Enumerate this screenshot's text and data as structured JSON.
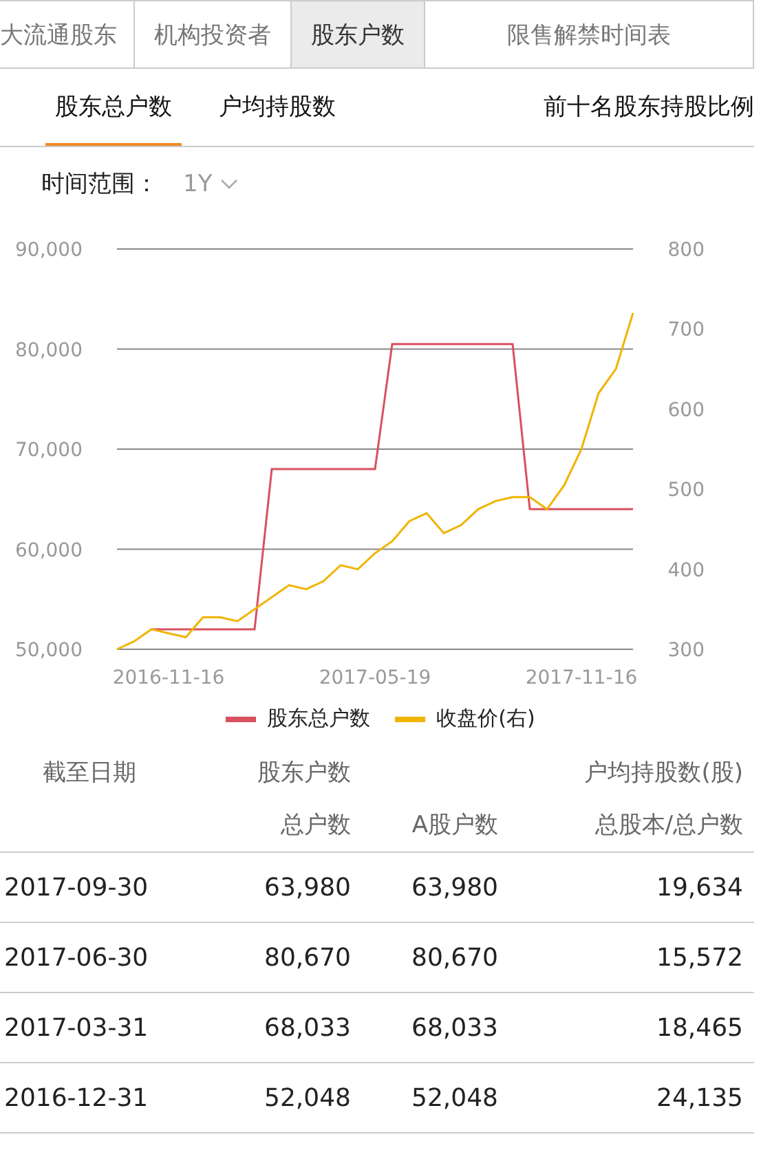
{
  "tabs": [
    {
      "label": "大流通股东",
      "selected": false
    },
    {
      "label": "机构投资者",
      "selected": false
    },
    {
      "label": "股东户数",
      "selected": true
    },
    {
      "label": "限售解禁时间表",
      "selected": false
    }
  ],
  "sub_tabs": [
    {
      "label": "股东总户数",
      "selected": true
    },
    {
      "label": "户均持股数",
      "selected": false
    },
    {
      "label": "前十名股东持股比例",
      "selected": false
    }
  ],
  "time_range": {
    "label": "时间范围：",
    "value": "1Y"
  },
  "chart": {
    "chart_data": {
      "type": "line",
      "categories": [
        null,
        null,
        null,
        "2016-11-16",
        null,
        null,
        null,
        null,
        null,
        null,
        null,
        null,
        null,
        null,
        null,
        "2017-05-19",
        null,
        null,
        null,
        null,
        null,
        null,
        null,
        null,
        null,
        null,
        null,
        "2017-11-16",
        null,
        null,
        null
      ],
      "ylim": [
        50000,
        90000
      ],
      "yticks": [
        {
          "value": 50000,
          "label": "50,000"
        },
        {
          "value": 60000,
          "label": "60,000"
        },
        {
          "value": 70000,
          "label": "70,000"
        },
        {
          "value": 80000,
          "label": "80,000"
        },
        {
          "value": 90000,
          "label": "90,000"
        }
      ],
      "grid": true,
      "legend": "bottom",
      "y2lim": [
        300,
        800
      ],
      "y2ticks": [
        300,
        400,
        500,
        600,
        700,
        800
      ],
      "series": [
        {
          "name": "股东总户数",
          "color": "#d9505f",
          "values": [
            null,
            null,
            52000,
            52000,
            52000,
            52000,
            52000,
            52000,
            52000,
            68000,
            68000,
            68000,
            68000,
            68000,
            68000,
            68000,
            80500,
            80500,
            80500,
            80500,
            80500,
            80500,
            80500,
            80500,
            64000,
            64000,
            64000,
            64000,
            64000,
            64000,
            64000
          ]
        },
        {
          "name": "收盘价(右)",
          "color": "#f0b400",
          "axis": "y2",
          "values": [
            300,
            310,
            325,
            320,
            315,
            340,
            340,
            335,
            350,
            365,
            380,
            375,
            385,
            405,
            400,
            420,
            435,
            460,
            470,
            445,
            455,
            475,
            485,
            490,
            490,
            475,
            505,
            550,
            620,
            650,
            720
          ]
        }
      ]
    }
  },
  "table": {
    "columns": [
      {
        "heading": "截至日期"
      },
      {
        "heading": "股东户数",
        "subheading": "总户数"
      },
      {
        "subheading": "A股户数"
      },
      {
        "heading": "户均持股数(股)",
        "subheading": "总股本/总户数"
      }
    ],
    "rows": [
      [
        "2017-09-30",
        "63,980",
        "63,980",
        "19,634"
      ],
      [
        "2017-06-30",
        "80,670",
        "80,670",
        "15,572"
      ],
      [
        "2017-03-31",
        "68,033",
        "68,033",
        "18,465"
      ],
      [
        "2016-12-31",
        "52,048",
        "52,048",
        "24,135"
      ]
    ]
  }
}
